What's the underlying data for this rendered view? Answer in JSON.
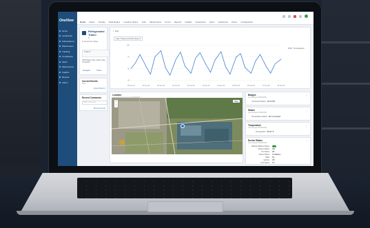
{
  "app": {
    "logo": "OneView",
    "nav": [
      "Home",
      "Landmarks",
      "Subscriptions",
      "Warehouses",
      "Tracking",
      "Compliance",
      "Alerts",
      "Maintenance",
      "Insights",
      "Reports",
      "Admin"
    ],
    "tabs": [
      "Home",
      "Fleets",
      "Overlay",
      "Data Relays",
      "Location History",
      "Jobs",
      "Maintenance",
      "Forms",
      "Reports",
      "Insights",
      "Inspections",
      "Alerts",
      "Geofences",
      "Zones",
      "Configuration"
    ],
    "active_tab": "Home"
  },
  "asset": {
    "name": "Refrigerated Trailer",
    "id": "6",
    "sub": "In service for 2 days",
    "status_label": "Trailer 6",
    "address": "3225 Water Way, Cedar Lake, CA 94015",
    "link_navigate": "Navigate",
    "link_share": "Share"
  },
  "left_cards": {
    "events_title": "Current Events",
    "events_sub": "None",
    "events_link": "Event History",
    "comments_title": "Recent Comments",
    "comments_placeholder": "Write a comment",
    "comments_link": "All Comments"
  },
  "chart_panel": {
    "header": "Day",
    "select": "Last 7 Days of Probe Temp 2",
    "legend": "Temperature"
  },
  "chart_data": {
    "type": "line",
    "categories": [
      "18 Sep 20",
      "19 Sep 20",
      "20 Sep 20",
      "21 Sep 20",
      "22 Sep 20",
      "23 Sep 20",
      "24 Sep 20",
      "25 Sep 20",
      "26 Sep 20",
      "27 Sep 20",
      "28 Sep 20"
    ],
    "yticks": [
      100,
      75,
      50,
      25
    ],
    "ylim": [
      20,
      105
    ],
    "series": [
      {
        "name": "Temperature",
        "color": "#3f7fd0",
        "x": [
          0,
          0.3,
          0.6,
          1,
          1.3,
          1.6,
          2,
          2.3,
          2.6,
          3,
          3.3,
          3.6,
          4,
          4.3,
          4.6,
          5,
          5.3,
          5.6,
          6,
          6.3,
          6.6,
          7,
          7.3,
          7.6,
          8,
          8.3,
          8.6,
          9,
          9.3,
          9.6,
          10
        ],
        "values": [
          50,
          62,
          80,
          55,
          38,
          75,
          88,
          52,
          36,
          70,
          85,
          55,
          40,
          72,
          84,
          58,
          42,
          68,
          86,
          54,
          38,
          74,
          82,
          52,
          40,
          66,
          80,
          55,
          40,
          60,
          70
        ]
      }
    ]
  },
  "location": {
    "title": "Location",
    "sub": "Last changed 2 hours ago 09/30/2020",
    "zoom_in": "+",
    "zoom_out": "−",
    "map_toggle": "Map"
  },
  "right_cards": {
    "badges_title": "Badges",
    "badges_sub": "Last changed 09/30/2020",
    "badges_kv": [
      [
        "Connected Status",
        "02:00 PM"
      ]
    ],
    "status_title": "Status",
    "status_sub": "Last changed 09/30/2020",
    "status_kv": [
      [
        "Temperature Status",
        "Not Connected"
      ]
    ],
    "temp_title": "Temperature",
    "temp_sub": "Last changed 09/30/2020",
    "temp_kv": [
      [
        "Temperature",
        "55.00 °F"
      ]
    ],
    "device_title": "Device Status",
    "device_sub": "Last changed 09/30/2020",
    "device_kv": [
      [
        "Backup Battery Status",
        "OK"
      ],
      [
        "Tamper Status",
        "Idle"
      ],
      [
        "Fix Status",
        "3D"
      ],
      [
        "Power Status",
        "On Battery"
      ],
      [
        "Stale",
        "No"
      ],
      [
        "Ignition",
        "Off"
      ],
      [
        "Unit Status",
        "On"
      ]
    ]
  },
  "colors": {
    "brand": "#1e4d7b",
    "accent": "#2c72c2",
    "series": "#3f7fd0",
    "ok": "#4caf50"
  }
}
